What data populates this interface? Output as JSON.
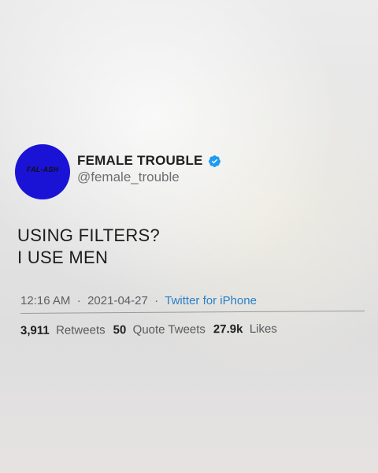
{
  "profile": {
    "avatar_text": "FAL-ASH",
    "display_name": "FEMALE TROUBLE",
    "handle": "@female_trouble",
    "avatar_color": "#1a13d6",
    "verified_icon": "verified-badge-icon",
    "verified_color": "#1d9bf0"
  },
  "tweet": {
    "lines": [
      "USING FILTERS?",
      "I USE MEN"
    ]
  },
  "meta": {
    "time": "12:16 AM",
    "separator": "·",
    "date": "2021-04-27",
    "source": "Twitter for iPhone"
  },
  "stats": {
    "retweets": {
      "count": "3,911",
      "label": "Retweets"
    },
    "quotes": {
      "count": "50",
      "label": "Quote Tweets"
    },
    "likes": {
      "count": "27.9k",
      "label": "Likes"
    }
  }
}
